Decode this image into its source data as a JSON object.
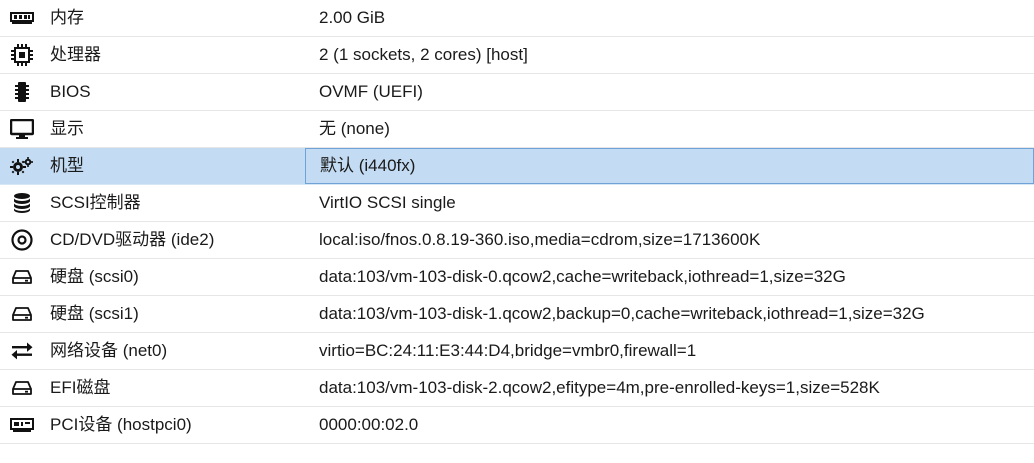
{
  "rows": [
    {
      "key": "内存",
      "value": "2.00 GiB",
      "icon": "memory-icon",
      "selected": false
    },
    {
      "key": "处理器",
      "value": "2 (1 sockets, 2 cores) [host]",
      "icon": "cpu-icon",
      "selected": false
    },
    {
      "key": "BIOS",
      "value": "OVMF (UEFI)",
      "icon": "chip-icon",
      "selected": false
    },
    {
      "key": "显示",
      "value": "无 (none)",
      "icon": "monitor-icon",
      "selected": false
    },
    {
      "key": "机型",
      "value": "默认 (i440fx)",
      "icon": "gears-icon",
      "selected": true
    },
    {
      "key": "SCSI控制器",
      "value": "VirtIO SCSI single",
      "icon": "database-icon",
      "selected": false
    },
    {
      "key": "CD/DVD驱动器 (ide2)",
      "value": "local:iso/fnos.0.8.19-360.iso,media=cdrom,size=1713600K",
      "icon": "cdrom-icon",
      "selected": false
    },
    {
      "key": "硬盘 (scsi0)",
      "value": "data:103/vm-103-disk-0.qcow2,cache=writeback,iothread=1,size=32G",
      "icon": "harddisk-icon",
      "selected": false
    },
    {
      "key": "硬盘 (scsi1)",
      "value": "data:103/vm-103-disk-1.qcow2,backup=0,cache=writeback,iothread=1,size=32G",
      "icon": "harddisk-icon",
      "selected": false
    },
    {
      "key": "网络设备 (net0)",
      "value": "virtio=BC:24:11:E3:44:D4,bridge=vmbr0,firewall=1",
      "icon": "exchange-icon",
      "selected": false
    },
    {
      "key": "EFI磁盘",
      "value": "data:103/vm-103-disk-2.qcow2,efitype=4m,pre-enrolled-keys=1,size=528K",
      "icon": "harddisk-icon",
      "selected": false
    },
    {
      "key": "PCI设备 (hostpci0)",
      "value": "0000:00:02.0",
      "icon": "pci-card-icon",
      "selected": false
    }
  ],
  "colors": {
    "selected_bg": "#c4dcf3",
    "selected_border": "#6fa2d6",
    "row_divider": "#e6e6e6"
  }
}
